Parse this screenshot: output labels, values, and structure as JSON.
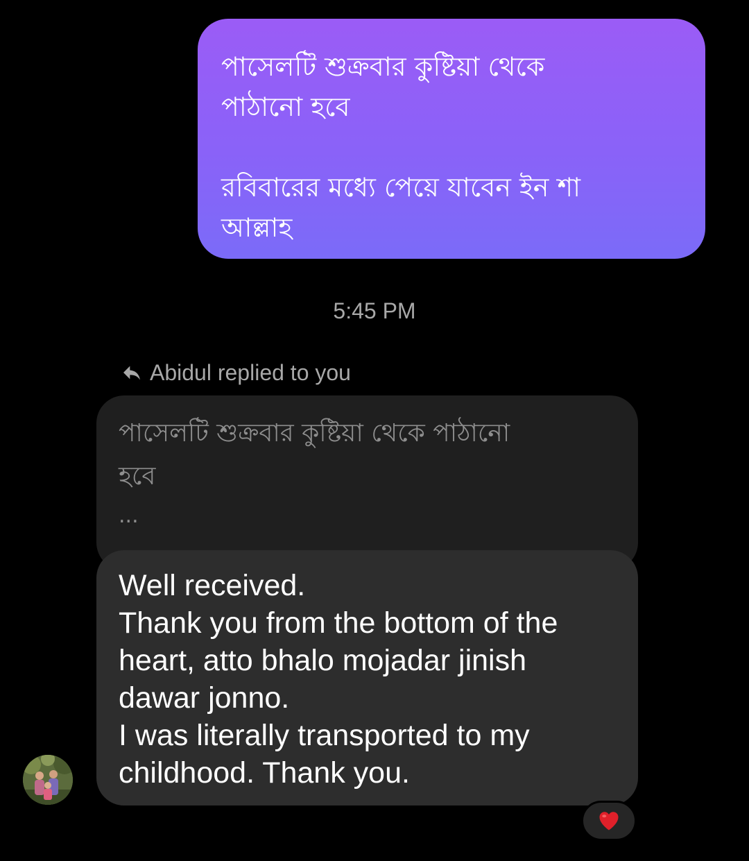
{
  "sent_message": {
    "line1": "পাসেলটি শুক্রবার কুষ্টিয়া থেকে",
    "line2": "পাঠানো হবে",
    "line3": "রবিবারের মধ্যে পেয়ে যাবেন ইন শা",
    "line4": "আল্লাহ"
  },
  "timestamp": "5:45 PM",
  "reply_header": {
    "icon": "reply-arrow-icon",
    "text": "Abidul replied to you"
  },
  "quoted_message": {
    "line1": "পাসেলটি শুক্রবার কুষ্টিয়া থেকে পাঠানো",
    "line2": "হবে",
    "ellipsis": "..."
  },
  "received_message": {
    "lines": [
      "Well received.",
      "Thank you from the bottom of the",
      "heart, atto bhalo mojadar jinish",
      "dawar jonno.",
      "I was literally transported to my",
      "childhood. Thank you."
    ]
  },
  "reaction": {
    "icon": "red-heart-icon",
    "color": "#e0202a"
  },
  "colors": {
    "sent_bubble_top": "#9b5cf6",
    "sent_bubble_bottom": "#7b6bf8",
    "received_bubble": "#2d2d2d",
    "quoted_bubble": "#1f1f1f",
    "background": "#000000"
  }
}
